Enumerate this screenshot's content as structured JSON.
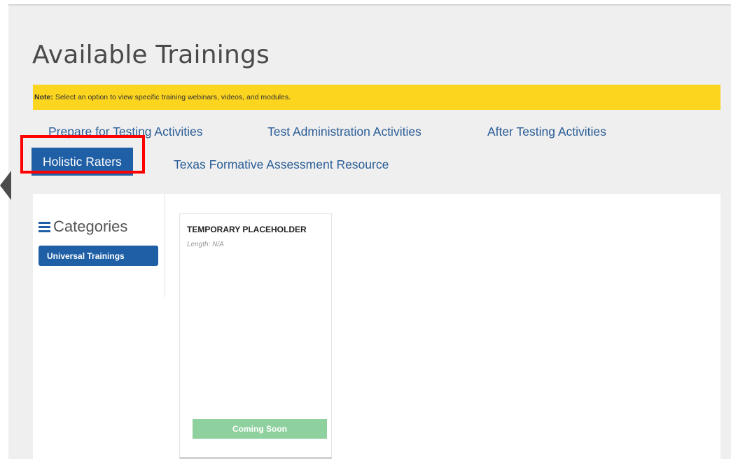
{
  "page": {
    "title": "Available Trainings",
    "note_label": "Note:",
    "note_text": "Select an option to view specific training webinars, videos, and modules."
  },
  "tabs": [
    {
      "label": "Prepare for Testing Activities"
    },
    {
      "label": "Test Administration Activities"
    },
    {
      "label": "After Testing Activities"
    },
    {
      "label": "Holistic Raters",
      "active": true
    },
    {
      "label": "Texas Formative Assessment Resource"
    }
  ],
  "sidebar": {
    "title": "Categories",
    "icon": "menu-icon",
    "items": [
      {
        "label": "Universal Trainings",
        "selected": true
      }
    ]
  },
  "cards": [
    {
      "title": "TEMPORARY PLACEHOLDER",
      "length": "Length: N/A",
      "button_label": "Coming Soon"
    }
  ],
  "colors": {
    "accent": "#1f5fa5",
    "note_bg": "#fcd51f",
    "highlight": "#ff0000",
    "coming_soon": "#8fd19e"
  }
}
